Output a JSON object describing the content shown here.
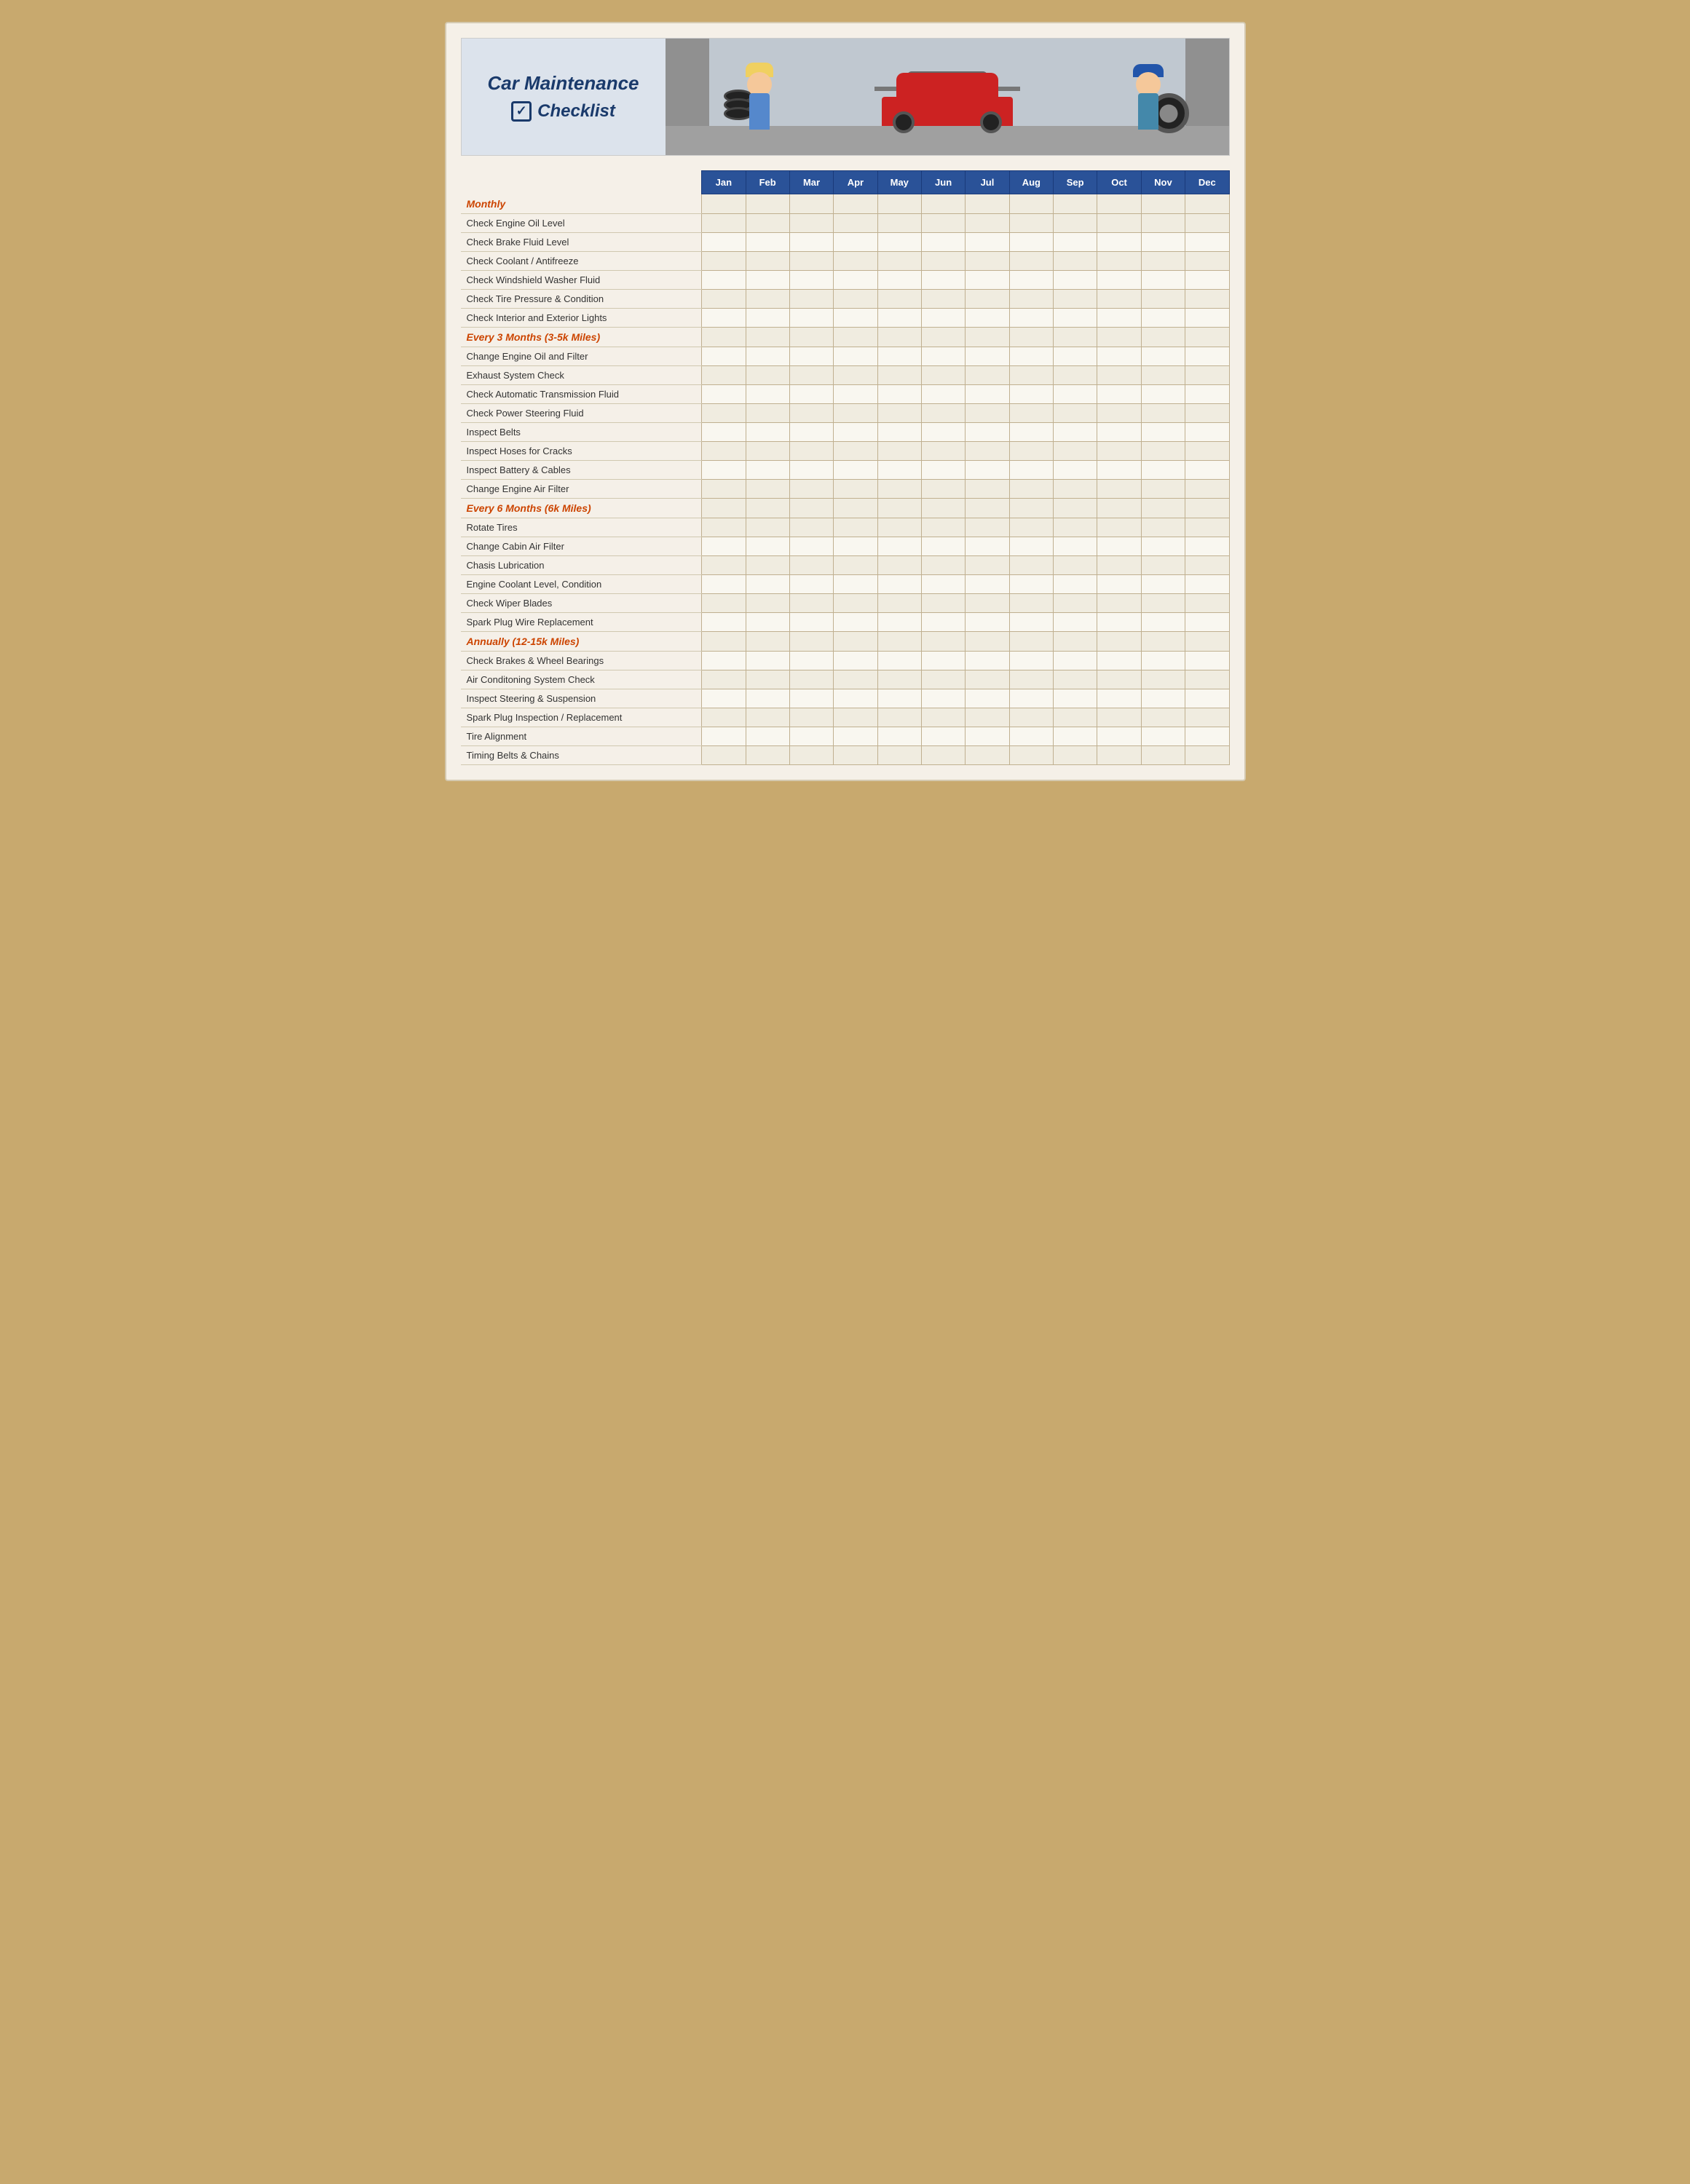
{
  "page": {
    "title": "Car Maintenance Checklist",
    "title_line1": "Car Maintenance",
    "title_line2": "Checklist"
  },
  "months": [
    "Jan",
    "Feb",
    "Mar",
    "Apr",
    "May",
    "Jun",
    "Jul",
    "Aug",
    "Sep",
    "Oct",
    "Nov",
    "Dec"
  ],
  "sections": [
    {
      "id": "monthly",
      "label": "Monthly",
      "style": "monthly",
      "items": [
        "Check Engine Oil Level",
        "Check Brake Fluid Level",
        "Check Coolant / Antifreeze",
        "Check Windshield Washer Fluid",
        "Check Tire Pressure & Condition",
        "Check Interior and Exterior Lights"
      ]
    },
    {
      "id": "every3months",
      "label": "Every 3 Months (3-5k Miles)",
      "style": "category",
      "items": [
        "Change Engine Oil and Filter",
        "Exhaust System Check",
        "Check Automatic Transmission Fluid",
        "Check Power Steering Fluid",
        "Inspect Belts",
        "Inspect Hoses for Cracks",
        "Inspect Battery & Cables",
        "Change Engine Air Filter"
      ]
    },
    {
      "id": "every6months",
      "label": "Every 6 Months (6k Miles)",
      "style": "category",
      "items": [
        "Rotate Tires",
        "Change Cabin Air Filter",
        "Chasis Lubrication",
        "Engine Coolant Level, Condition",
        "Check Wiper Blades",
        "Spark Plug Wire Replacement"
      ]
    },
    {
      "id": "annually",
      "label": "Annually (12-15k Miles)",
      "style": "category",
      "items": [
        "Check Brakes & Wheel Bearings",
        "Air Conditoning System Check",
        "Inspect Steering & Suspension",
        "Spark Plug Inspection / Replacement",
        "Tire Alignment",
        "Timing Belts & Chains"
      ]
    }
  ]
}
